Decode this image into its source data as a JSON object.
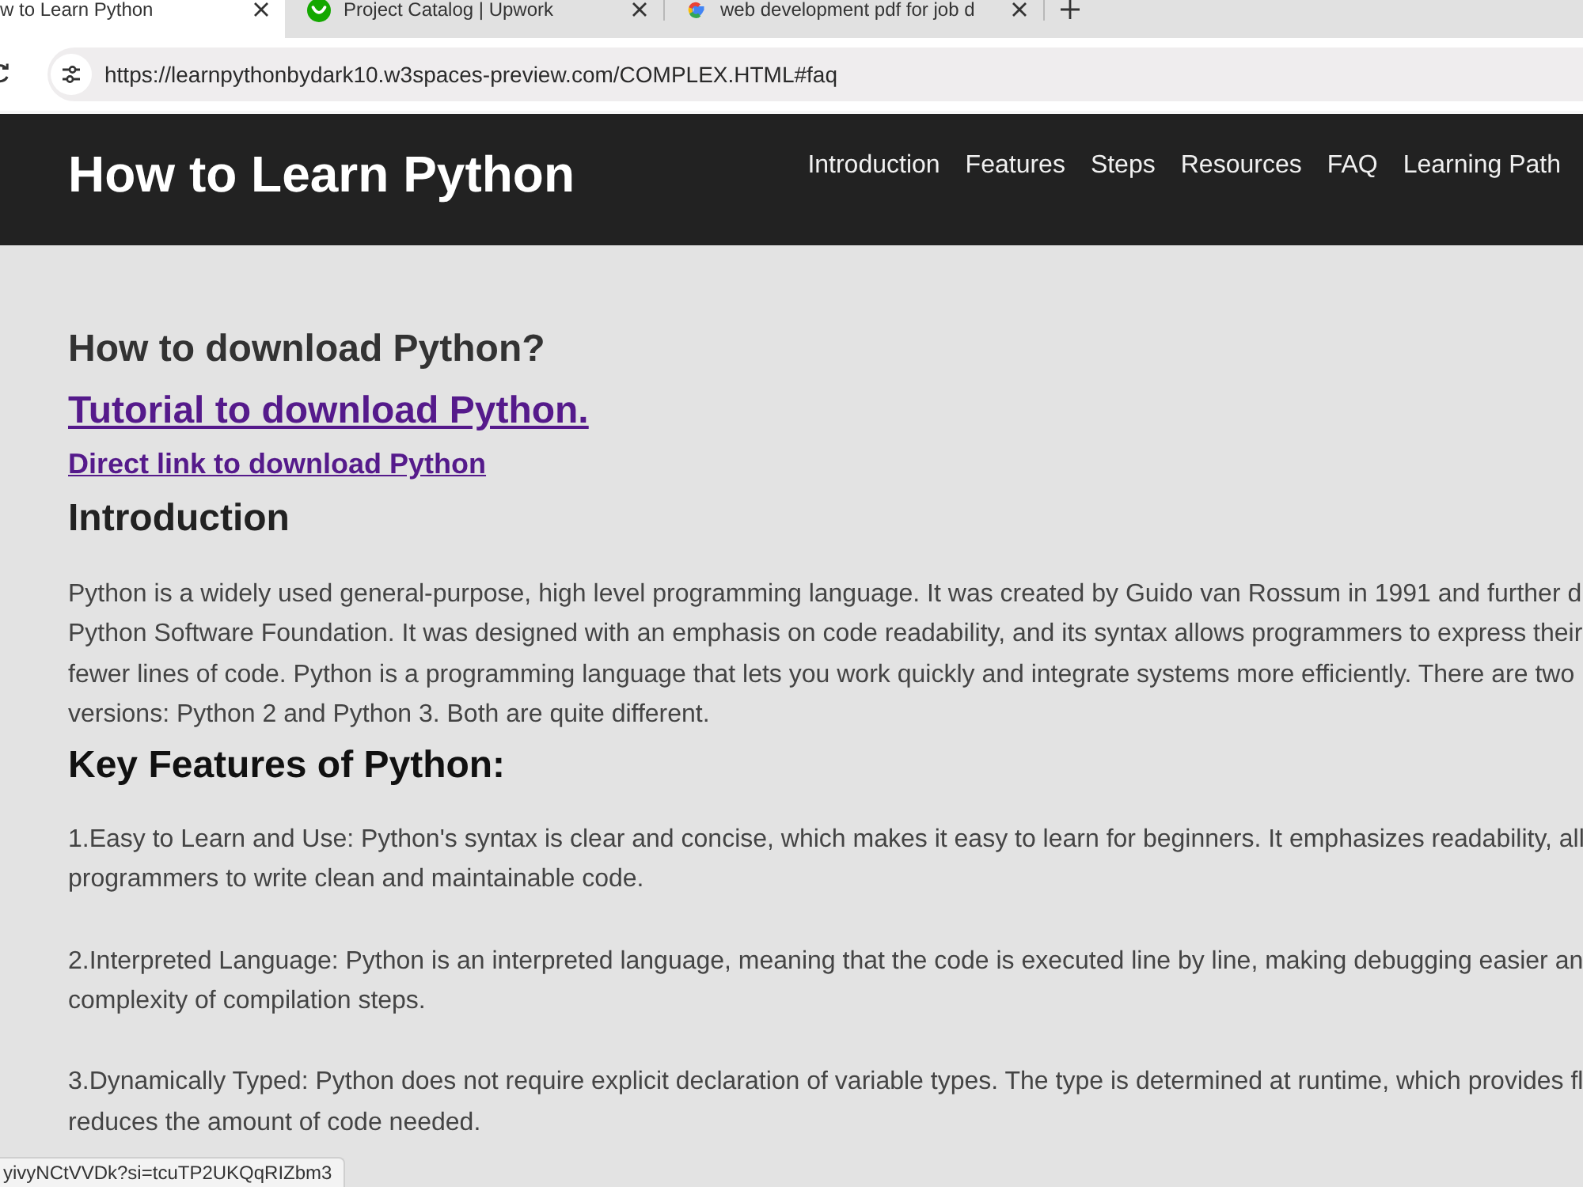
{
  "browser": {
    "tabs": [
      {
        "title": "w to Learn Python",
        "selected": true,
        "kind": "plain"
      },
      {
        "title": "Project Catalog | Upwork",
        "selected": false,
        "kind": "upwork"
      },
      {
        "title": "web development pdf for job d",
        "selected": false,
        "kind": "google"
      }
    ],
    "address": "https://learnpythonbydark10.w3spaces-preview.com/COMPLEX.HTML#faq"
  },
  "header": {
    "title": "How to Learn Python",
    "nav": [
      "Introduction",
      "Features",
      "Steps",
      "Resources",
      "FAQ",
      "Learning Path"
    ]
  },
  "download": {
    "heading": "How to download Python?",
    "links": [
      {
        "text": "Tutorial to download Python.",
        "kind": "large"
      },
      {
        "text": "Direct link to download Python",
        "kind": "small"
      }
    ]
  },
  "introduction": {
    "heading": "Introduction",
    "lines": [
      "Python is a widely used general-purpose, high level programming language. It was created by Guido van Rossum in 1991 and further d",
      "Python Software Foundation. It was designed with an emphasis on code readability, and its syntax allows programmers to express their",
      "fewer lines of code. Python is a programming language that lets you work quickly and integrate systems more efficiently. There are two",
      "versions: Python 2 and Python 3. Both are quite different."
    ]
  },
  "features": {
    "heading": "Key Features of Python:",
    "items": [
      {
        "lines": [
          "1.Easy to Learn and Use: Python's syntax is clear and concise, which makes it easy to learn for beginners. It emphasizes readability, all",
          "programmers to write clean and maintainable code."
        ]
      },
      {
        "lines": [
          "2.Interpreted Language: Python is an interpreted language, meaning that the code is executed line by line, making debugging easier an",
          "complexity of compilation steps."
        ]
      },
      {
        "lines": [
          "3.Dynamically Typed: Python does not require explicit declaration of variable types. The type is determined at runtime, which provides fl",
          "reduces the amount of code needed."
        ]
      }
    ]
  },
  "status_url": "yivyNCtVVDk?si=tcuTP2UKQqRIZbm3"
}
